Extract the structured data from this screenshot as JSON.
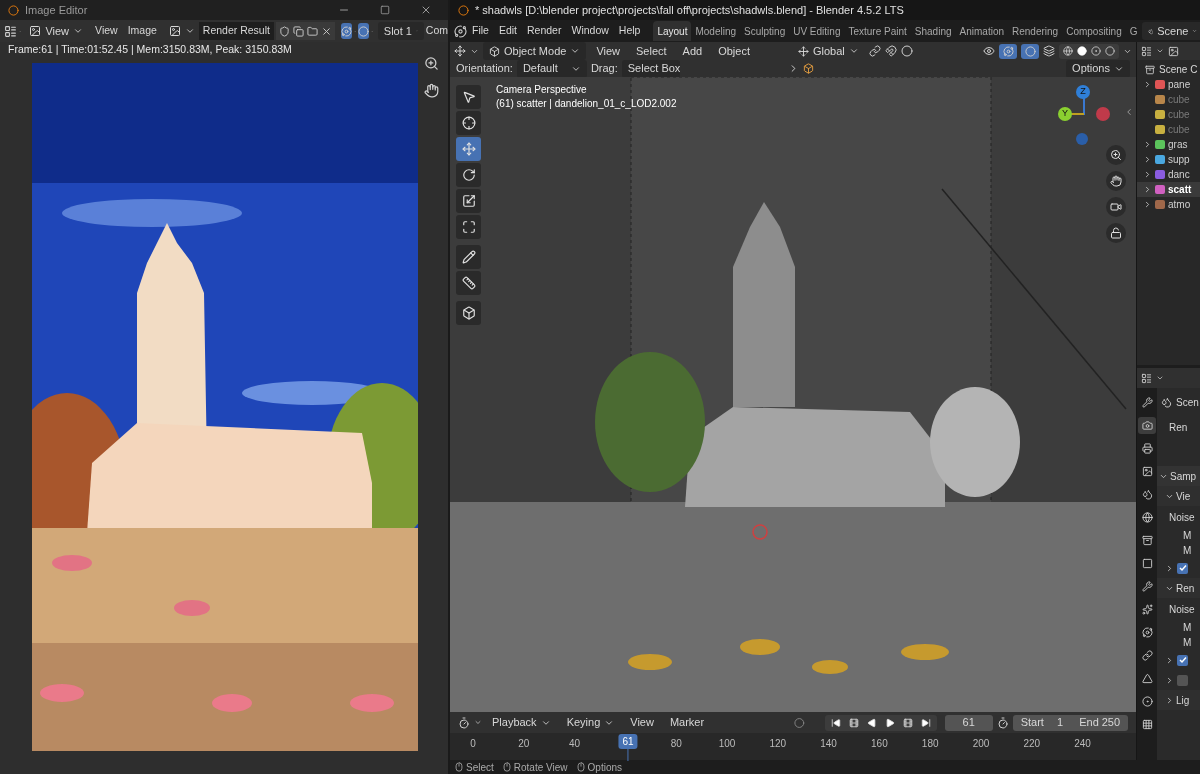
{
  "image_editor": {
    "title": "Image Editor",
    "menus": [
      "View",
      "View",
      "Image"
    ],
    "image_name": "Render Result",
    "slot": "Slot 1",
    "cut_label": "Com",
    "info": "Frame:61 | Time:01:52.45 | Mem:3150.83M, Peak: 3150.83M"
  },
  "blender": {
    "title": "* shadwls [D:\\blender project\\projects\\fall off\\projects\\shadwls.blend] - Blender 4.5.2 LTS",
    "menus": [
      "File",
      "Edit",
      "Render",
      "Window",
      "Help"
    ],
    "workspaces": [
      {
        "label": "Layout",
        "selected": true
      },
      {
        "label": "Modeling",
        "selected": false
      },
      {
        "label": "Sculpting",
        "selected": false
      },
      {
        "label": "UV Editing",
        "selected": false
      },
      {
        "label": "Texture Paint",
        "selected": false
      },
      {
        "label": "Shading",
        "selected": false
      },
      {
        "label": "Animation",
        "selected": false
      },
      {
        "label": "Rendering",
        "selected": false
      },
      {
        "label": "Compositing",
        "selected": false
      },
      {
        "label": "G",
        "selected": false
      }
    ],
    "scene": "Scene"
  },
  "viewport": {
    "mode": "Object Mode",
    "menus": [
      "View",
      "Select",
      "Add",
      "Object"
    ],
    "transform": "Global",
    "orientation_label": "Orientation:",
    "orientation": "Default",
    "drag_label": "Drag:",
    "drag": "Select Box",
    "options": "Options",
    "camera_label": "Camera Perspective",
    "object_label": "(61) scatter | dandelion_01_c_LOD2.002",
    "tools": [
      {
        "kind": "select",
        "selected": false
      },
      {
        "kind": "cursor",
        "selected": false
      },
      {
        "kind": "move",
        "selected": true
      },
      {
        "kind": "rotate",
        "selected": false
      },
      {
        "kind": "scale",
        "selected": false
      },
      {
        "kind": "transform",
        "selected": false
      },
      {
        "kind": "annotate",
        "selected": false
      },
      {
        "kind": "measure",
        "selected": false
      },
      {
        "kind": "add-cube",
        "selected": false
      }
    ],
    "gizmo_axes": [
      "Z",
      "Y"
    ]
  },
  "outliner": {
    "root": "Scene C",
    "items": [
      {
        "label": "pane",
        "color": "#e05555",
        "expandable": true,
        "dimmed": false,
        "selected": false
      },
      {
        "label": "cube",
        "color": "#b8864a",
        "expandable": false,
        "dimmed": true,
        "selected": false
      },
      {
        "label": "cube",
        "color": "#c8b040",
        "expandable": false,
        "dimmed": true,
        "selected": false
      },
      {
        "label": "cube",
        "color": "#c8b040",
        "expandable": false,
        "dimmed": true,
        "selected": false
      },
      {
        "label": "gras",
        "color": "#5cc45c",
        "expandable": true,
        "dimmed": false,
        "selected": false
      },
      {
        "label": "supp",
        "color": "#4aa8e0",
        "expandable": true,
        "dimmed": false,
        "selected": false
      },
      {
        "label": "danc",
        "color": "#8a5ce0",
        "expandable": true,
        "dimmed": false,
        "selected": false
      },
      {
        "label": "scatt",
        "color": "#d060c0",
        "expandable": true,
        "dimmed": false,
        "selected": true
      },
      {
        "label": "atmo",
        "color": "#a0684a",
        "expandable": true,
        "dimmed": false,
        "selected": false
      }
    ]
  },
  "properties": {
    "scene_label": "Scen",
    "tabs": [
      {
        "kind": "tool",
        "selected": false
      },
      {
        "kind": "render",
        "selected": true
      },
      {
        "kind": "output",
        "selected": false
      },
      {
        "kind": "view-layer",
        "selected": false
      },
      {
        "kind": "scene",
        "selected": false
      },
      {
        "kind": "world",
        "selected": false
      },
      {
        "kind": "collection",
        "selected": false
      },
      {
        "kind": "object",
        "selected": false
      },
      {
        "kind": "modifier",
        "selected": false
      },
      {
        "kind": "particles",
        "selected": false
      },
      {
        "kind": "physics",
        "selected": false
      },
      {
        "kind": "constraint",
        "selected": false
      },
      {
        "kind": "data",
        "selected": false
      },
      {
        "kind": "material",
        "selected": false
      },
      {
        "kind": "texture",
        "selected": false
      }
    ],
    "rows": [
      {
        "kind": "label",
        "text": "Ren"
      },
      {
        "kind": "gap"
      },
      {
        "kind": "panel",
        "text": "Samp",
        "expanded": true
      },
      {
        "kind": "subpanel",
        "text": "Vie",
        "expanded": true
      },
      {
        "kind": "label",
        "text": "Noise"
      },
      {
        "kind": "field",
        "text": "M"
      },
      {
        "kind": "field",
        "text": "M"
      },
      {
        "kind": "check",
        "checked": true
      },
      {
        "kind": "subpanel",
        "text": "Ren",
        "expanded": true
      },
      {
        "kind": "label",
        "text": "Noise"
      },
      {
        "kind": "field",
        "text": "M"
      },
      {
        "kind": "field",
        "text": "M"
      },
      {
        "kind": "check",
        "checked": true
      },
      {
        "kind": "check",
        "checked": false
      },
      {
        "kind": "subpanel",
        "text": "Lig",
        "expanded": false
      }
    ]
  },
  "timeline": {
    "menus": [
      "Playback",
      "Keying",
      "View",
      "Marker"
    ],
    "current": "61",
    "playhead_frame": "61",
    "start_label": "Start",
    "start": "1",
    "end_label": "End",
    "end": "250",
    "ticks": [
      "0",
      "20",
      "40",
      "80",
      "100",
      "120",
      "140",
      "160",
      "180",
      "200",
      "220",
      "240"
    ]
  },
  "status_bar": [
    "Select",
    "Rotate View",
    "Options"
  ]
}
